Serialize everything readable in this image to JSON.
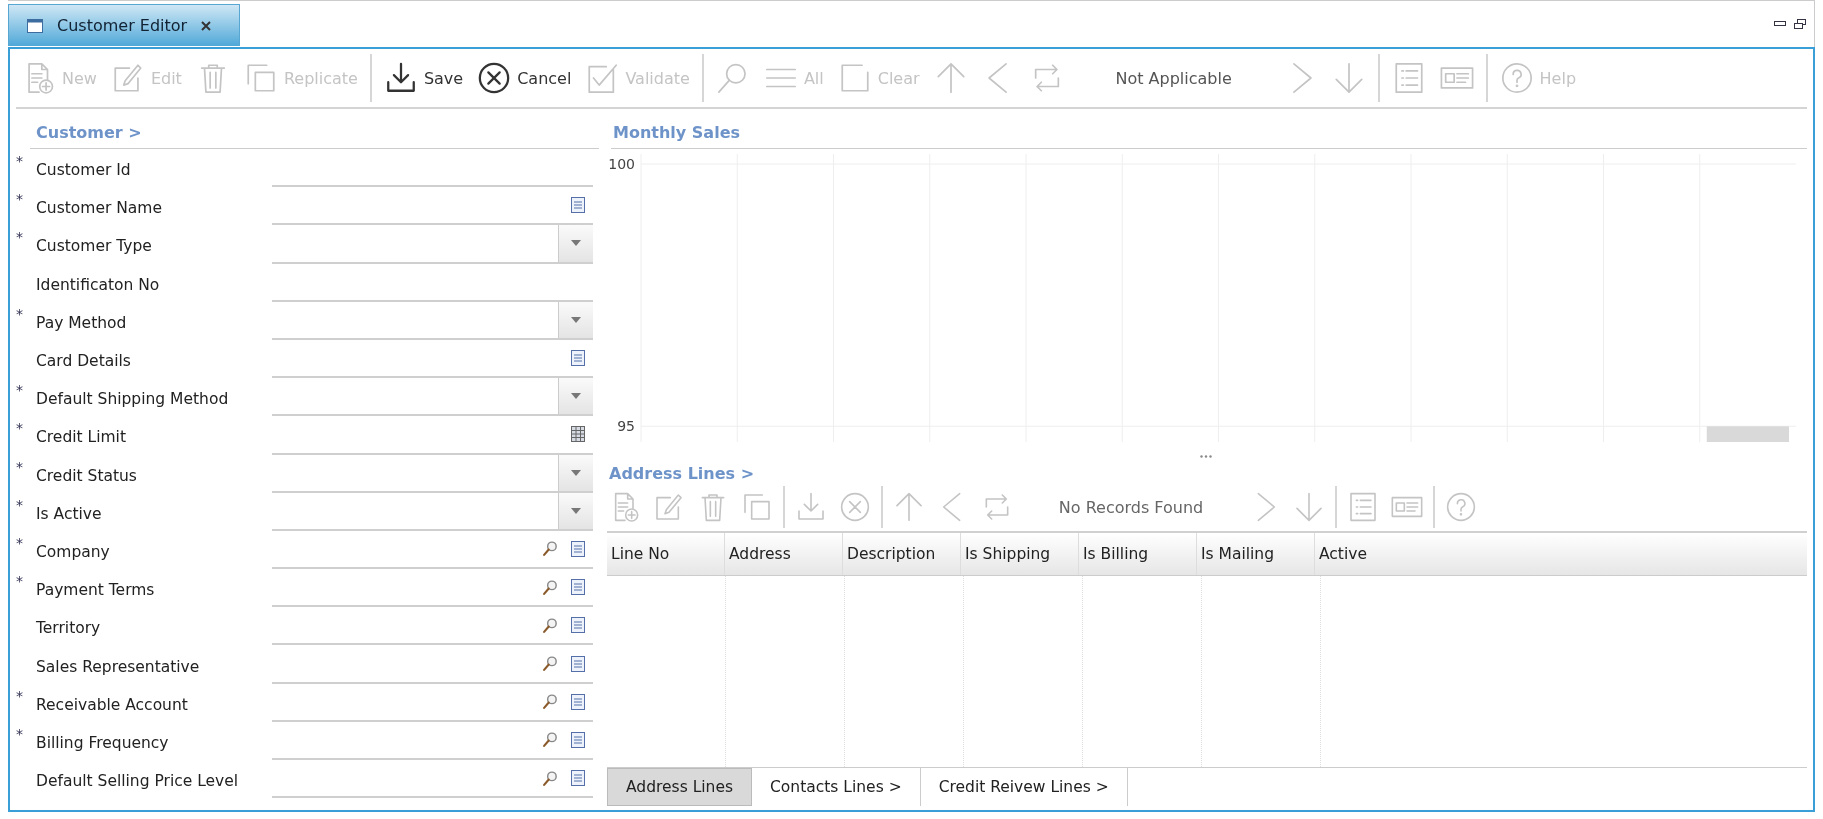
{
  "window": {
    "title": "Customer Editor"
  },
  "toolbar": [
    {
      "kind": "new",
      "label": "New",
      "disabled": true
    },
    {
      "kind": "edit",
      "label": "Edit",
      "disabled": true
    },
    {
      "kind": "delete",
      "disabled": true
    },
    {
      "kind": "replicate",
      "label": "Replicate",
      "disabled": true
    },
    {
      "kind": "separator"
    },
    {
      "kind": "save",
      "label": "Save",
      "disabled": false
    },
    {
      "kind": "cancel",
      "label": "Cancel",
      "disabled": false
    },
    {
      "kind": "validate",
      "label": "Validate",
      "disabled": true
    },
    {
      "kind": "separator"
    },
    {
      "kind": "search",
      "disabled": true
    },
    {
      "kind": "all",
      "label": "All",
      "disabled": true
    },
    {
      "kind": "clear",
      "label": "Clear",
      "disabled": true
    },
    {
      "kind": "first",
      "disabled": true
    },
    {
      "kind": "prev",
      "disabled": true
    },
    {
      "kind": "refresh",
      "disabled": true
    },
    {
      "kind": "status",
      "label": "Not Applicable"
    },
    {
      "kind": "next",
      "disabled": true
    },
    {
      "kind": "last",
      "disabled": true
    },
    {
      "kind": "separator"
    },
    {
      "kind": "list",
      "disabled": true
    },
    {
      "kind": "form",
      "disabled": true
    },
    {
      "kind": "separator"
    },
    {
      "kind": "help",
      "label": "Help",
      "disabled": true
    }
  ],
  "form": {
    "title": "Customer >",
    "fields": [
      {
        "label": "Customer Id",
        "marker": "*",
        "kind": "text"
      },
      {
        "label": "Customer Name",
        "marker": "*",
        "kind": "memo"
      },
      {
        "label": "Customer Type",
        "marker": "*",
        "kind": "select"
      },
      {
        "label": "Identificaton No",
        "kind": "text"
      },
      {
        "label": "Pay Method",
        "marker": "*",
        "kind": "select"
      },
      {
        "label": "Card Details",
        "kind": "memo"
      },
      {
        "label": "Default Shipping Method",
        "marker": "*",
        "kind": "select"
      },
      {
        "label": "Credit Limit",
        "marker": "*",
        "kind": "number"
      },
      {
        "label": "Credit Status",
        "marker": "*",
        "kind": "select"
      },
      {
        "label": "Is Active",
        "marker": "*",
        "kind": "select"
      },
      {
        "label": "Company",
        "marker": "*",
        "kind": "lookup"
      },
      {
        "label": "Payment Terms",
        "marker": "*",
        "kind": "lookup"
      },
      {
        "label": "Territory",
        "kind": "lookup"
      },
      {
        "label": "Sales Representative",
        "kind": "lookup"
      },
      {
        "label": "Receivable Account",
        "marker": "*",
        "kind": "lookup"
      },
      {
        "label": "Billing Frequency",
        "marker": "*",
        "kind": "lookup"
      },
      {
        "label": "Default Selling Price Level",
        "kind": "lookup"
      }
    ]
  },
  "monthly_sales": {
    "title": "Monthly Sales",
    "chart_data": {
      "type": "bar",
      "values": [
        null,
        null,
        null,
        null,
        null,
        null,
        null,
        null,
        null,
        null,
        null,
        95
      ],
      "ylim": [
        94.7,
        100
      ],
      "yticks": [
        95,
        100
      ]
    }
  },
  "address_lines": {
    "title": "Address Lines >",
    "toolbar": [
      {
        "kind": "new",
        "disabled": true
      },
      {
        "kind": "edit",
        "disabled": true
      },
      {
        "kind": "delete",
        "disabled": true
      },
      {
        "kind": "replicate",
        "disabled": true
      },
      {
        "kind": "separator"
      },
      {
        "kind": "save",
        "disabled": true
      },
      {
        "kind": "cancel",
        "disabled": true
      },
      {
        "kind": "separator"
      },
      {
        "kind": "first",
        "disabled": true
      },
      {
        "kind": "prev",
        "disabled": true
      },
      {
        "kind": "refresh",
        "disabled": true
      },
      {
        "kind": "status",
        "label": "No Records Found"
      },
      {
        "kind": "next",
        "disabled": true
      },
      {
        "kind": "last",
        "disabled": true
      },
      {
        "kind": "separator"
      },
      {
        "kind": "list",
        "disabled": true
      },
      {
        "kind": "form",
        "disabled": true
      },
      {
        "kind": "separator"
      },
      {
        "kind": "help",
        "disabled": true
      }
    ],
    "table": {
      "columns": [
        "Line No",
        "Address",
        "Description",
        "Is Shipping",
        "Is Billing",
        "Is Mailing",
        "Active"
      ]
    }
  },
  "bottom_tabs": [
    {
      "label": "Address Lines",
      "selected": true
    },
    {
      "label": "Contacts Lines >",
      "selected": false
    },
    {
      "label": "Credit Reivew Lines >",
      "selected": false
    }
  ]
}
